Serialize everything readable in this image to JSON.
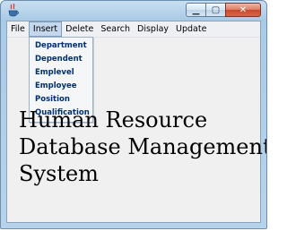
{
  "window": {
    "controls": {
      "minimize_icon": "minimize-icon",
      "maximize_icon": "maximize-icon",
      "close_icon": "close-icon"
    }
  },
  "menubar": {
    "items": [
      "File",
      "Insert",
      "Delete",
      "Search",
      "Display",
      "Update"
    ],
    "active": "Insert"
  },
  "insert_menu": {
    "items": [
      "Department",
      "Dependent",
      "Emplevel",
      "Employee",
      "Position",
      "Qualification"
    ]
  },
  "banner": {
    "lines": [
      "Human Resource",
      "Database Management",
      "System"
    ]
  },
  "colors": {
    "menu_text": "#003070",
    "highlight": "#c5d7ec",
    "frame": "#b7d3eb"
  }
}
